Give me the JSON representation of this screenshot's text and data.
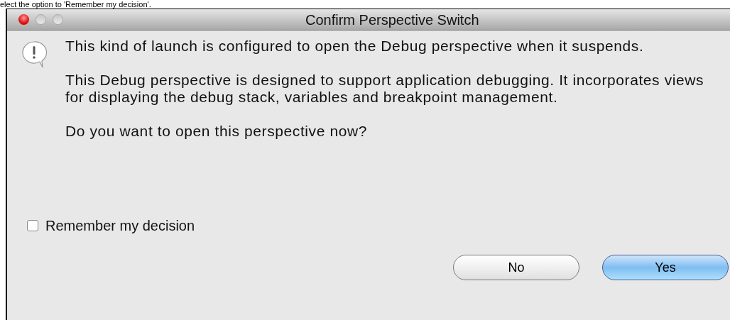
{
  "caption": "elect the option to 'Remember my decision'.",
  "window": {
    "title": "Confirm Perspective Switch"
  },
  "message": {
    "paragraphs": [
      "This kind of launch is configured to open the Debug perspective when it suspends.",
      "This Debug perspective is designed to support application debugging.  It incorporates views for displaying the debug stack, variables and breakpoint management.",
      "Do you want to open this perspective now?"
    ]
  },
  "remember": {
    "label": "Remember my decision",
    "checked": false
  },
  "buttons": [
    {
      "label": "No",
      "selected": false
    },
    {
      "label": "Yes",
      "selected": true
    }
  ]
}
